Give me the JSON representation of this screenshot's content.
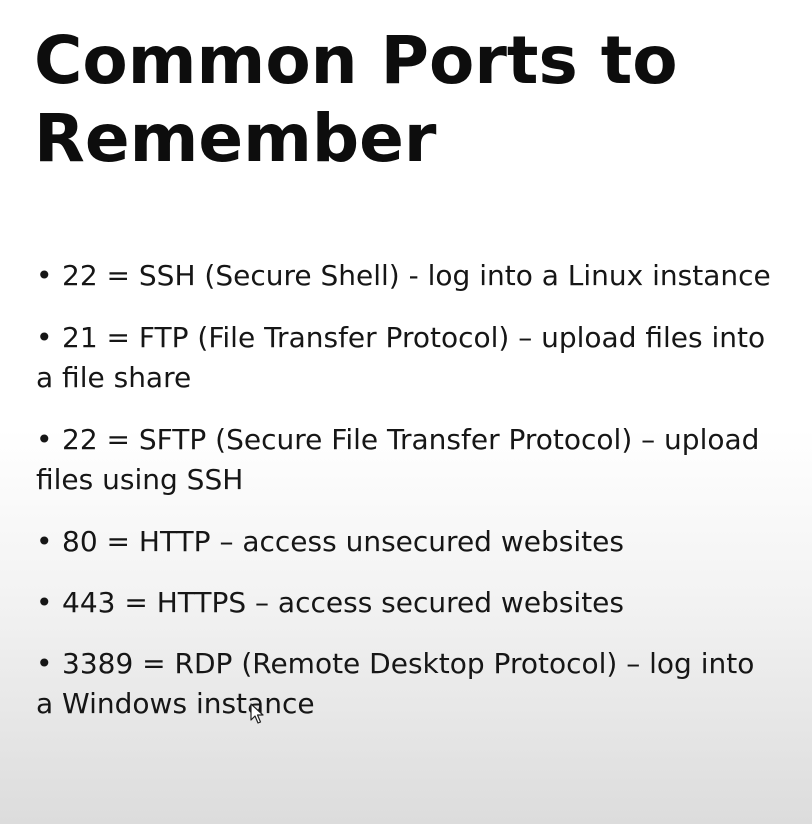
{
  "slide": {
    "title": "Common Ports to Remember",
    "bullet_glyph": "•",
    "bullets": [
      {
        "text": "22 = SSH (Secure Shell) - log into a Linux instance"
      },
      {
        "text": "21 = FTP (File Transfer Protocol) – upload files into a file share"
      },
      {
        "text": "22 = SFTP (Secure File Transfer Protocol) – upload files using SSH"
      },
      {
        "text": "80 = HTTP – access unsecured websites"
      },
      {
        "text": "443 = HTTPS – access secured websites"
      },
      {
        "text": "3389 = RDP (Remote Desktop Protocol) – log into a Windows instance"
      }
    ]
  },
  "cursor_icon": "mouse-pointer-icon",
  "colors": {
    "text": "#111111",
    "background_top": "#ffffff",
    "background_bottom": "#dcdcdc"
  }
}
